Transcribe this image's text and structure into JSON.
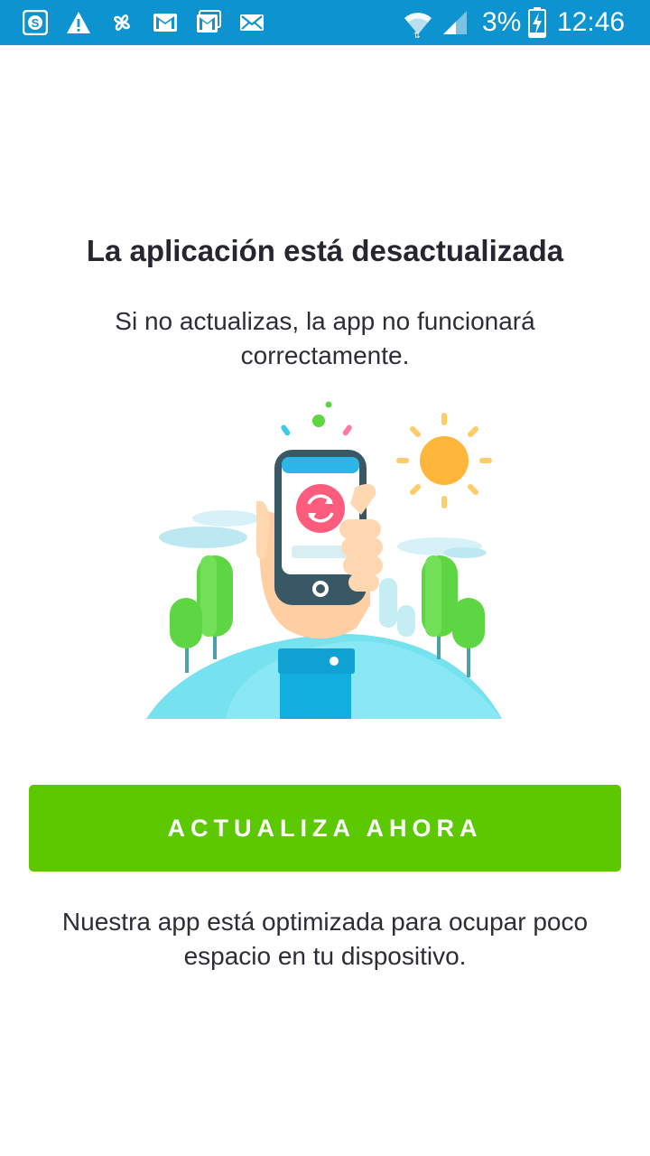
{
  "status_bar": {
    "left_icons": [
      "skype-icon",
      "warning-icon",
      "pinwheel-icon",
      "gmail-icon",
      "gmail-stack-icon",
      "email-icon"
    ],
    "right_icons": [
      "wifi-icon",
      "signal-icon",
      "battery-charging-icon"
    ],
    "battery_percent": "3%",
    "time": "12:46",
    "background_color": "#0d93cf"
  },
  "dialog": {
    "title": "La aplicación está desactualizada",
    "message": "Si no actualizas, la app no funcionará correctamente.",
    "illustration_icon": "phone-update-illustration",
    "action_label": "ACTUALIZA AHORA",
    "action_color": "#5cc800",
    "footnote": "Nuestra app está optimizada para ocupar poco espacio en tu dispositivo."
  }
}
